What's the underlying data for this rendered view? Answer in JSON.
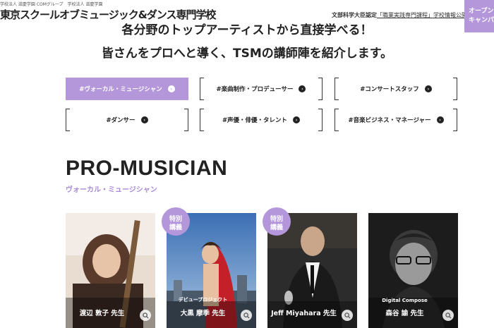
{
  "header": {
    "group_line": "学校法人 滋慶学園 COMグループ　学校法人 滋慶学園",
    "school_name": "東京スクールオブミュージック&ダンス専門学校",
    "accreditation_prefix": "文部科学大臣認定",
    "accreditation_link": "「職業実践専門課程」学校情報公開",
    "campus_line1": "オープン",
    "campus_line2": "キャンパス"
  },
  "headline": {
    "line1": "各分野のトップアーティストから直接学べる！",
    "line2": "皆さんをプロへと導く、TSMの講師陣を紹介します。"
  },
  "categories": [
    {
      "label": "#ヴォーカル・ミュージシャン",
      "active": true
    },
    {
      "label": "#楽曲制作・プロデューサー",
      "active": false
    },
    {
      "label": "#コンサートスタッフ",
      "active": false
    },
    {
      "label": "#ダンサー",
      "active": false
    },
    {
      "label": "#声優・俳優・タレント",
      "active": false
    },
    {
      "label": "#音楽ビジネス・マネージャー",
      "active": false
    }
  ],
  "section": {
    "title": "PRO-MUSICIAN",
    "subtitle": "ヴォーカル・ミュージシャン"
  },
  "instructors": [
    {
      "name": "渡辺 敦子 先生",
      "sub": "",
      "badge": ""
    },
    {
      "name": "大黒 摩季 先生",
      "sub": "デビュープロジェクト",
      "badge": "特別\n講義"
    },
    {
      "name": "Jeff Miyahara 先生",
      "sub": "",
      "badge": "特別\n講義"
    },
    {
      "name": "森谷 諭 先生",
      "sub": "Digital Compose",
      "badge": ""
    }
  ],
  "arrow_glyph": "›",
  "colors": {
    "accent": "#b497db",
    "accent_text": "#a98ad6"
  },
  "icons": {
    "card_zoom": "search-icon",
    "category_arrow": "arrow-right-icon"
  }
}
